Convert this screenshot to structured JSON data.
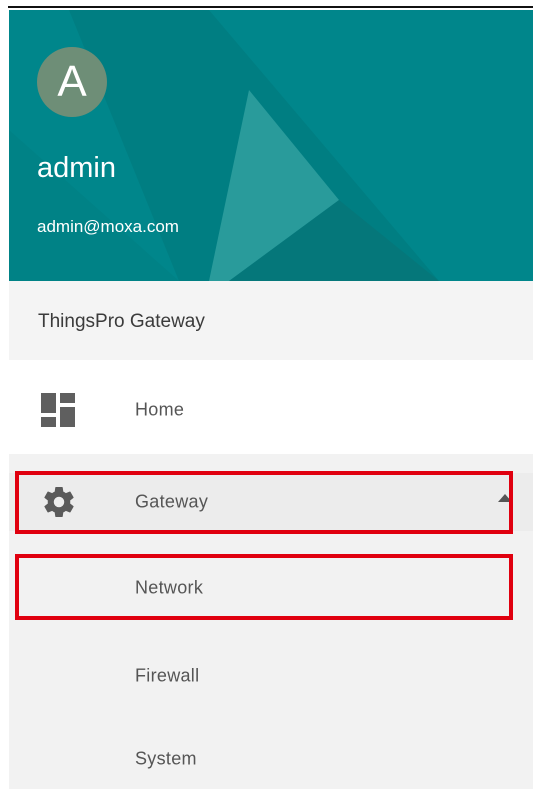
{
  "user": {
    "avatar_letter": "A",
    "name": "admin",
    "email": "admin@moxa.com"
  },
  "app": {
    "title": "ThingsPro Gateway"
  },
  "menu": {
    "home": {
      "label": "Home",
      "icon": "dashboard-icon"
    },
    "gateway": {
      "label": "Gateway",
      "icon": "gear-icon",
      "expanded": true
    },
    "submenu": [
      {
        "label": "Network"
      },
      {
        "label": "Firewall"
      },
      {
        "label": "System"
      }
    ]
  },
  "colors": {
    "banner": "#00868b",
    "avatar": "#6e8e77",
    "highlight": "#e0000f",
    "submenu_background": "#f2f2f2"
  }
}
